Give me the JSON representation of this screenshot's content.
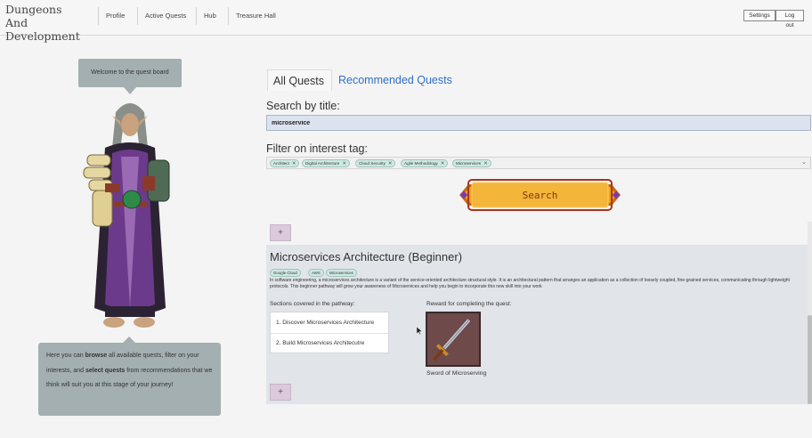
{
  "brand": {
    "line1": "Dungeons",
    "line2": "And Development"
  },
  "nav": {
    "profile": "Profile",
    "active_quests": "Active Quests",
    "hub": "Hub",
    "treasure_hall": "Treasure Hall",
    "settings": "Settings",
    "logout": "Log out"
  },
  "guide": {
    "welcome": "Welcome to the quest board",
    "intro_1": "Here you can ",
    "intro_browse": "browse",
    "intro_2": " all available quests, filter on your interests, and ",
    "intro_select": "select quests",
    "intro_3": " from recommendations that we think will suit you at this stage of your journey!"
  },
  "tabs": {
    "all": "All Quests",
    "recommended": "Recommended Quests"
  },
  "search": {
    "label": "Search by title:",
    "value": "microservice"
  },
  "filter": {
    "label": "Filter on interest tag:",
    "tags": [
      "Architect",
      "Digital Architecture",
      "Cloud Security",
      "Agile Methodology",
      "Microservices"
    ]
  },
  "search_button": "Search",
  "plus_label": "+",
  "quest": {
    "title": "Microservices Architecture (Beginner)",
    "tags": [
      "Google Cloud",
      "AWS",
      "Microservices"
    ],
    "description": "In software engineering, a microservices architecture is a variant of the service-oriented architecture structural style. It is an architectural pattern that arranges an application as a collection of loosely coupled, fine-grained services, communicating through lightweight protocols. This beginner pathway will grow your awareness of Microservices and help you begin to incorporate this new skill into your work",
    "sections_label": "Sections covered in the pathway:",
    "sections": [
      "1. Discover Microservices Architecture",
      "2. Build Microservices Architecutre"
    ],
    "reward_label": "Reward for completing the quest:",
    "reward_name": "Sword of Microserving"
  },
  "colors": {
    "accent_blue": "#2f6fc6",
    "bubble": "#a3afb0",
    "chip": "#cfe8e2",
    "plus_bg": "#dcc9dc",
    "search_btn": "#f0a21a"
  }
}
